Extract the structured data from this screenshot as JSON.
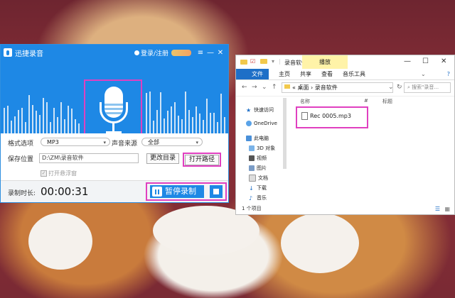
{
  "recorder": {
    "app_name": "迅捷录音",
    "login_text": "登录/注册",
    "window_controls": [
      "≡",
      "—",
      "✕"
    ],
    "format_label": "格式选项",
    "format_value": "MP3",
    "source_label": "声音来源",
    "source_value": "全部",
    "save_label": "保存位置",
    "save_path": "D:\\ZM\\录音软件",
    "change_dir_label": "更改目录",
    "open_path_label": "打开路径",
    "float_window_label": "打开悬浮窗",
    "duration_label": "录制时长:",
    "duration_value": "00:00:31",
    "pause_label": "暂停录制"
  },
  "explorer": {
    "title": "录音软件",
    "tool_tab": "播放",
    "ribbon_tabs": [
      "文件",
      "主页",
      "共享",
      "查看",
      "音乐工具"
    ],
    "breadcrumb_prefix": "«",
    "breadcrumb": [
      "桌面",
      "录音软件"
    ],
    "search_placeholder": "搜索\"录音...",
    "columns": [
      "名称",
      "#",
      "标题"
    ],
    "nav_items": [
      "快速访问",
      "OneDrive",
      "此电脑",
      "3D 对象",
      "视频",
      "图片",
      "文档",
      "下载",
      "音乐"
    ],
    "files": [
      "Rec 0005.mp3"
    ],
    "status_text": "1 个项目"
  }
}
